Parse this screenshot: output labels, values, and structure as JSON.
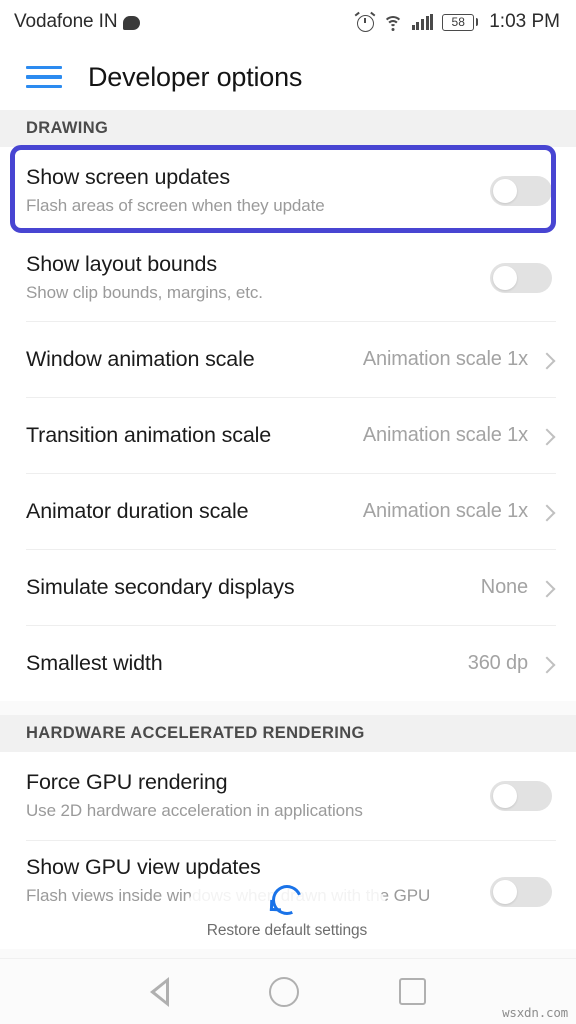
{
  "status_bar": {
    "carrier": "Vodafone IN",
    "message_icon": "message-bubble-icon",
    "alarm_icon": "alarm-clock-icon",
    "wifi_icon": "wifi-icon",
    "signal_icon": "cellular-signal-icon",
    "battery_icon": "battery-icon",
    "battery_level": "58",
    "time": "1:03 PM"
  },
  "app_bar": {
    "menu_icon": "hamburger-menu-icon",
    "menu_color": "#2C8BF0",
    "title": "Developer options"
  },
  "highlight": {
    "color": "#4845D2",
    "target": "Show screen updates"
  },
  "sections": [
    {
      "header": "DRAWING",
      "rows": [
        {
          "title": "Show screen updates",
          "subtitle": "Flash areas of screen when they update",
          "control": "switch",
          "state": "off",
          "highlighted": true
        },
        {
          "title": "Show layout bounds",
          "subtitle": "Show clip bounds, margins, etc.",
          "control": "switch",
          "state": "off",
          "highlighted": false
        },
        {
          "title": "Window animation scale",
          "subtitle": "",
          "control": "value",
          "value": "Animation scale 1x",
          "highlighted": false
        },
        {
          "title": "Transition animation scale",
          "subtitle": "",
          "control": "value",
          "value": "Animation scale 1x",
          "highlighted": false
        },
        {
          "title": "Animator duration scale",
          "subtitle": "",
          "control": "value",
          "value": "Animation scale 1x",
          "highlighted": false
        },
        {
          "title": "Simulate secondary displays",
          "subtitle": "",
          "control": "value",
          "value": "None",
          "highlighted": false
        },
        {
          "title": "Smallest width",
          "subtitle": "",
          "control": "value",
          "value": "360 dp",
          "highlighted": false
        }
      ]
    },
    {
      "header": "HARDWARE ACCELERATED RENDERING",
      "rows": [
        {
          "title": "Force GPU rendering",
          "subtitle": "Use 2D hardware acceleration in applications",
          "control": "switch",
          "state": "off",
          "highlighted": false
        },
        {
          "title": "Show GPU view updates",
          "subtitle": "Flash views inside windows when drawn with the GPU",
          "control": "switch",
          "state": "off",
          "highlighted": false
        }
      ]
    }
  ],
  "toast": {
    "spinner_icon": "loading-spinner-icon",
    "spinner_color": "#1a73e8",
    "label": "Restore default settings"
  },
  "nav_bar": {
    "back_icon": "back-triangle-icon",
    "home_icon": "home-circle-icon",
    "recents_icon": "recents-square-icon"
  },
  "watermark": "wsxdn.com"
}
